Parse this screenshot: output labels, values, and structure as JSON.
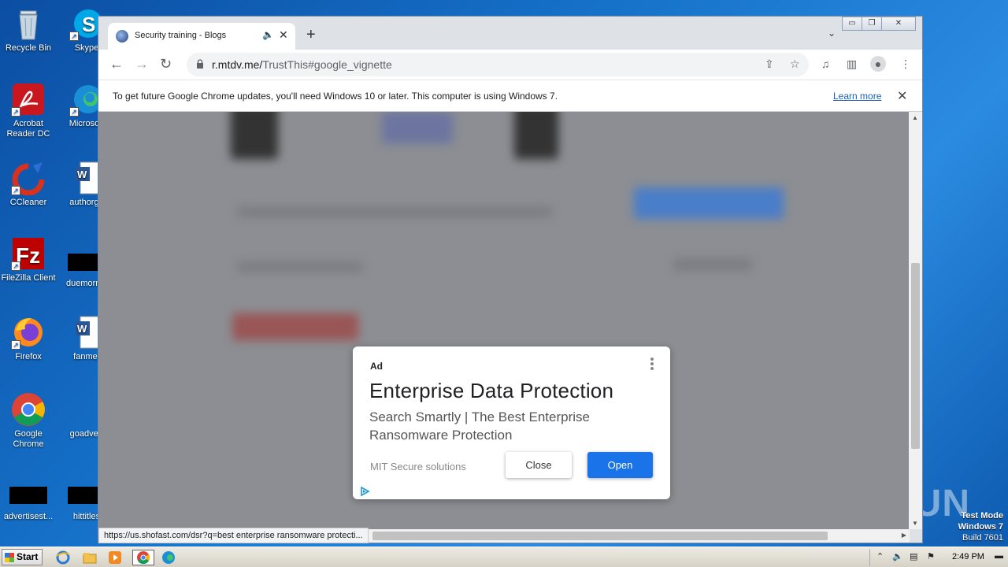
{
  "desktop": {
    "icons": [
      {
        "label": "Recycle Bin"
      },
      {
        "label": "Skype"
      },
      {
        "label": "Acrobat Reader DC"
      },
      {
        "label": "Microsoft"
      },
      {
        "label": "CCleaner"
      },
      {
        "label": "authorgo"
      },
      {
        "label": "FileZilla Client"
      },
      {
        "label": "duemornin"
      },
      {
        "label": "Firefox"
      },
      {
        "label": "fanmet"
      },
      {
        "label": "Google Chrome"
      },
      {
        "label": "goadvert"
      },
      {
        "label": "advertisest..."
      },
      {
        "label": "hittitles"
      }
    ],
    "watermark": "ANY RUN",
    "testmode": {
      "line1": "Test Mode",
      "line2": "Windows 7",
      "line3": "Build 7601"
    }
  },
  "browser": {
    "tab": {
      "title": "Security training - Blogs"
    },
    "address": {
      "host": "r.mtdv.me/",
      "path": "TrustThis#google_vignette"
    },
    "infobar": {
      "message": "To get future Google Chrome updates, you'll need Windows 10 or later. This computer is using Windows 7.",
      "link": "Learn more"
    },
    "status_url": "https://us.shofast.com/dsr?q=best enterprise ransomware protecti..."
  },
  "ad": {
    "label": "Ad",
    "title": "Enterprise Data Protection",
    "subtitle": "Search Smartly | The Best Enterprise Ransomware Protection",
    "advertiser": "MIT Secure solutions",
    "close_label": "Close",
    "open_label": "Open",
    "accent": "#1a73e8"
  },
  "taskbar": {
    "start_label": "Start",
    "clock": "2:49 PM"
  }
}
